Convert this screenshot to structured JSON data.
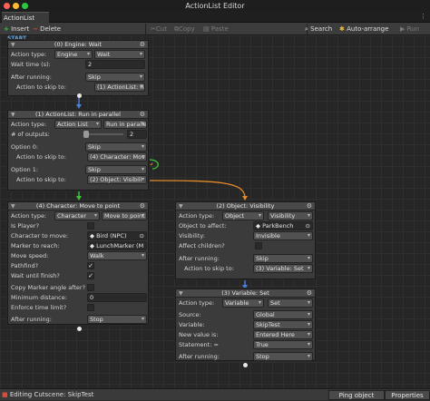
{
  "window": {
    "title": "ActionList Editor"
  },
  "tab": {
    "label": "ActionList Editor",
    "menu": "⋮"
  },
  "toolbar": {
    "insert": "Insert",
    "delete": "Delete",
    "cut": "Cut",
    "copy": "Copy",
    "paste": "Paste",
    "search": "Search",
    "auto_arrange": "Auto-arrange",
    "run": "Run"
  },
  "start_label": "START",
  "nodes": {
    "engine_wait": {
      "title": "(0) Engine: Wait",
      "action_type_label": "Action type:",
      "action_cat": "Engine",
      "action_name": "Wait",
      "wait_time_label": "Wait time (s):",
      "wait_time": "2",
      "after_running_label": "After running:",
      "after_running": "Skip",
      "skip_to_label": "Action to skip to:",
      "skip_to": "(1) ActionList: Run in"
    },
    "actionlist_run": {
      "title": "(1) ActionList: Run in parallel",
      "action_type_label": "Action type:",
      "action_cat": "Action List",
      "action_name": "Run in paralle",
      "outputs_label": "# of outputs:",
      "outputs": "2",
      "option0_label": "Option 0:",
      "option0": "Skip",
      "skip0_label": "Action to skip to:",
      "skip0": "(4) Character: Mov",
      "option1_label": "Option 1:",
      "option1": "Skip",
      "skip1_label": "Action to skip to:",
      "skip1": "(2) Object: Visibili"
    },
    "character_move": {
      "title": "(4) Character: Move to point",
      "action_type_label": "Action type:",
      "action_cat": "Character",
      "action_name": "Move to point",
      "is_player_label": "Is Player?",
      "char_label": "Character to move:",
      "char_value": "Bird (NPC)",
      "marker_label": "Marker to reach:",
      "marker_value": "LunchMarker (M",
      "speed_label": "Move speed:",
      "speed_value": "Walk",
      "pathfind_label": "Pathfind?",
      "pathfind_check": "✓",
      "wait_label": "Wait until finish?",
      "wait_check": "✓",
      "copy_angle_label": "Copy Marker angle after?",
      "min_dist_label": "Minimum distance:",
      "min_dist": "0",
      "enforce_label": "Enforce time limit?",
      "after_running_label": "After running:",
      "after_running": "Stop"
    },
    "object_visibility": {
      "title": "(2) Object: Visibility",
      "action_type_label": "Action type:",
      "action_cat": "Object",
      "action_name": "Visibility",
      "object_label": "Object to affect:",
      "object_value": "ParkBench",
      "visibility_label": "Visibility:",
      "visibility_value": "Invisible",
      "children_label": "Affect children?",
      "after_running_label": "After running:",
      "after_running": "Skip",
      "skip_to_label": "Action to skip to:",
      "skip_to": "(3) Variable: Set"
    },
    "variable_set": {
      "title": "(3) Variable: Set",
      "action_type_label": "Action type:",
      "action_cat": "Variable",
      "action_name": "Set",
      "source_label": "Source:",
      "source_value": "Global",
      "variable_label": "Variable:",
      "variable_value": "SkipTest",
      "new_value_label": "New value is:",
      "new_value": "Entered Here",
      "statement_label": "Statement: =",
      "statement_value": "True",
      "after_running_label": "After running:",
      "after_running": "Stop"
    }
  },
  "status": {
    "text": "Editing Cutscene: SkipTest",
    "ping_object": "Ping object",
    "properties": "Properties"
  },
  "colors": {
    "wire_blue": "#4a7fd8",
    "wire_orange": "#e08a2a",
    "wire_green": "#3ec23e",
    "start_blue": "#5fa0e0"
  }
}
